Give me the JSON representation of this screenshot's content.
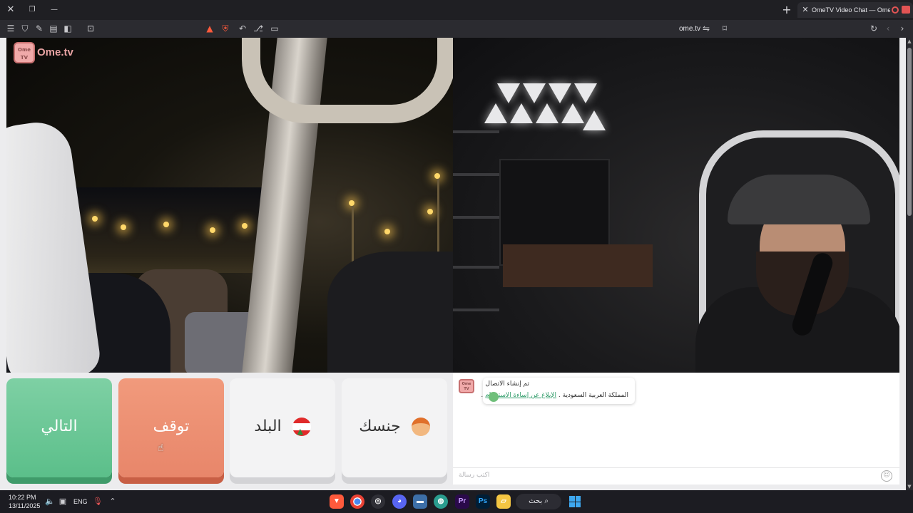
{
  "browser": {
    "window_controls": {
      "close": "✕",
      "restore": "❐",
      "minimize": "—"
    },
    "new_tab": "+",
    "tab": {
      "close": "✕",
      "title": "OmeTV Video Chat — Omeg"
    },
    "address": {
      "url": "ome.tv"
    }
  },
  "logo": {
    "badge": "Ome TV",
    "text": "Ome.tv"
  },
  "controls": {
    "next": "التالي",
    "stop": "توقف",
    "country": "البلد",
    "gender": "جنسك"
  },
  "chat": {
    "logo": "Ome TV",
    "message_line1": "تم إنشاء الاتصال",
    "message_country": "المملكة العربية السعودية",
    "message_link": "الإبلاغ عن إساءة الاستخدام",
    "input_placeholder": "اكتب رسالة"
  },
  "taskbar": {
    "time": "10:22 PM",
    "date": "13/11/2025",
    "language": "ENG",
    "search_label": "بحث"
  },
  "colors": {
    "next_button": "#6cc796",
    "stop_button": "#ec8d70",
    "link": "#2e9b68",
    "accent": "#3ea8f0"
  }
}
